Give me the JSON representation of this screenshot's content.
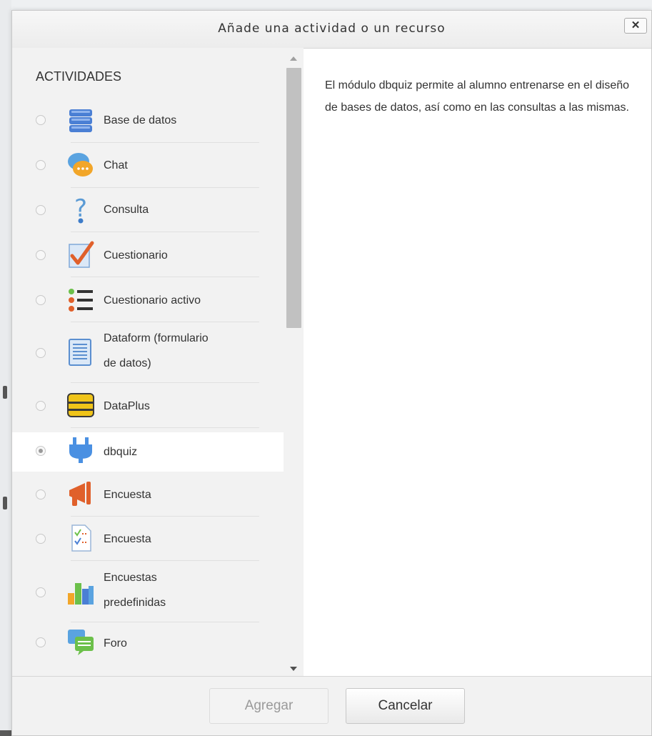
{
  "dialog": {
    "title": "Añade una actividad o un recurso",
    "close_label": "✕"
  },
  "list": {
    "heading": "ACTIVIDADES",
    "items": [
      {
        "label": "Base de datos",
        "icon": "database-icon",
        "selected": false
      },
      {
        "label": "Chat",
        "icon": "chat-icon",
        "selected": false
      },
      {
        "label": "Consulta",
        "icon": "question-icon",
        "selected": false
      },
      {
        "label": "Cuestionario",
        "icon": "quiz-icon",
        "selected": false
      },
      {
        "label": "Cuestionario activo",
        "icon": "list-icon",
        "selected": false
      },
      {
        "label": "Dataform (formulario de datos)",
        "line1": "Dataform (formulario",
        "line2": "de datos)",
        "icon": "dataform-icon",
        "selected": false
      },
      {
        "label": "DataPlus",
        "icon": "dataplus-icon",
        "selected": false
      },
      {
        "label": "dbquiz",
        "icon": "plug-icon",
        "selected": true
      },
      {
        "label": "Encuesta",
        "icon": "megaphone-icon",
        "selected": false
      },
      {
        "label": "Encuesta",
        "icon": "survey-icon",
        "selected": false
      },
      {
        "label": "Encuestas predefinidas",
        "line1": "Encuestas",
        "line2": "predefinidas",
        "icon": "bar-chart-icon",
        "selected": false
      },
      {
        "label": "Foro",
        "icon": "forum-icon",
        "selected": false
      }
    ]
  },
  "description": "El módulo dbquiz permite al alumno entrenarse en el diseño de bases de datos, así como en las consultas a las mismas.",
  "footer": {
    "add_label": "Agregar",
    "cancel_label": "Cancelar"
  },
  "colors": {
    "selected_row": "#ffffff",
    "panel_bg": "#f2f2f2",
    "text": "#333333"
  }
}
